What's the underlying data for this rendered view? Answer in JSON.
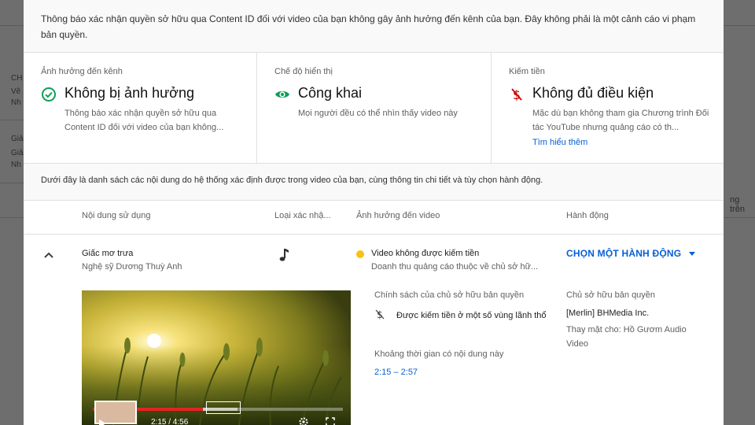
{
  "background": {
    "left_fragments": [
      "CH",
      "Vẽ",
      "Nh",
      "Giả",
      "Giả",
      "Nh"
    ],
    "right_fragment": "ng trên"
  },
  "notice": "Thông báo xác nhận quyền sở hữu qua Content ID đối với video của bạn không gây ảnh hưởng đến kênh của bạn. Đây không phải là một cảnh cáo vi phạm bản quyền.",
  "cards": {
    "channel": {
      "label": "Ảnh hưởng đến kênh",
      "value": "Không bị ảnh hưởng",
      "desc": "Thông báo xác nhận quyền sở hữu qua Content ID đối với video của bạn không...",
      "icon": "check-circle-icon"
    },
    "visibility": {
      "label": "Chế độ hiển thị",
      "value": "Công khai",
      "desc": "Mọi người đều có thể nhìn thấy video này",
      "icon": "eye-icon"
    },
    "monetization": {
      "label": "Kiếm tiền",
      "value": "Không đủ điều kiện",
      "desc": "Mặc dù bạn không tham gia Chương trình Đối tác YouTube nhưng quảng cáo có th...",
      "link": "Tìm hiểu thêm",
      "icon": "no-money-icon"
    }
  },
  "intro": "Dưới đây là danh sách các nội dung do hệ thống xác định được trong video của bạn, cùng thông tin chi tiết và tùy chọn hành động.",
  "table": {
    "headers": [
      "Nội dung sử dụng",
      "Loại xác nhậ...",
      "Ảnh hưởng đến video",
      "Hành động"
    ]
  },
  "claim": {
    "title": "Giấc mơ trưa",
    "artist": "Nghệ sỹ Dương Thuỳ Anh",
    "type_icon": "music-note-icon",
    "impact": "Video không được kiếm tiền",
    "impact_sub": "Doanh thu quảng cáo thuộc về chủ sở hữ...",
    "action": "CHỌN MỘT HÀNH ĐỘNG",
    "policy_label": "Chính sách của chủ sở hữu bản quyền",
    "policy_value": "Được kiếm tiền ở một số vùng lãnh thổ",
    "span_label": "Khoảng thời gian có nội dung này",
    "span_value": "2:15 – 2:57",
    "owner_label": "Chủ sở hữu bản quyền",
    "owner": "[Merlin] BHMedia Inc.",
    "owner_sub": "Thay mặt cho: Hồ Gươm Audio Video",
    "player_time": "2:15 / 4:56",
    "progress": 0.44
  },
  "colors": {
    "accent": "#065fd4",
    "check": "#0f9d58",
    "warn": "#cc0000",
    "dot": "#f9c113"
  }
}
